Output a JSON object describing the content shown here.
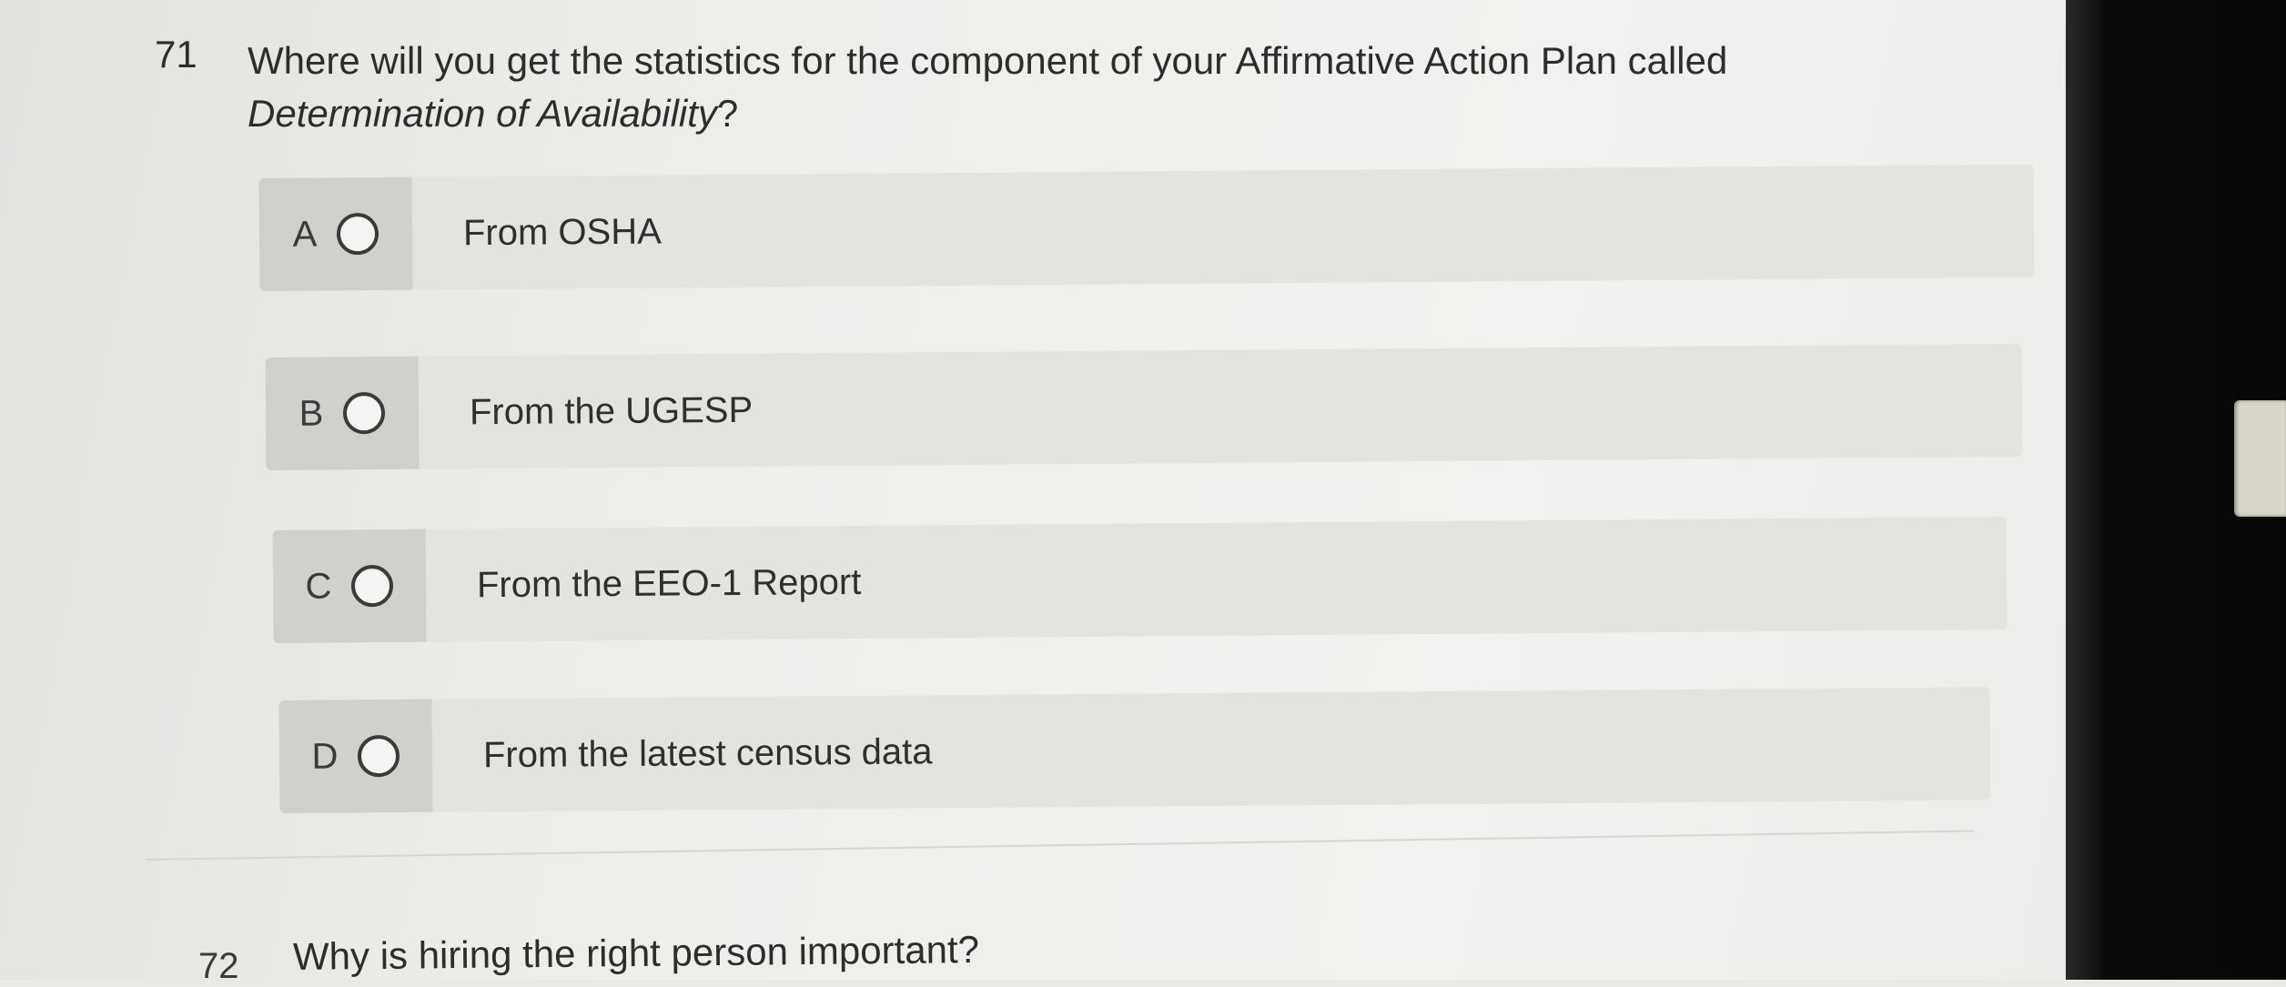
{
  "question": {
    "number": "71",
    "text_part1": "Where will you get the statistics for the component of your Affirmative Action Plan called",
    "text_emphasis": "Determination of Availability",
    "text_part2": "?"
  },
  "options": [
    {
      "letter": "A",
      "text": "From OSHA"
    },
    {
      "letter": "B",
      "text": "From the UGESP"
    },
    {
      "letter": "C",
      "text": "From the EEO-1 Report"
    },
    {
      "letter": "D",
      "text": "From the latest census data"
    }
  ],
  "next_question": {
    "number": "72",
    "text": "Why is hiring the right person important?"
  }
}
